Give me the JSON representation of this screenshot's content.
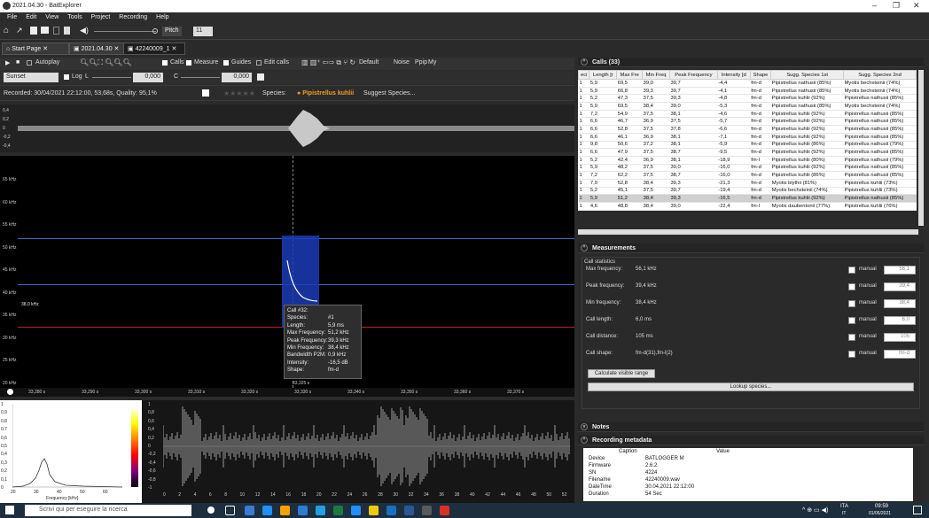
{
  "window": {
    "title": "2021.04.30 - BatExplorer",
    "minimize": "–",
    "maximize": "❐",
    "close": "✕"
  },
  "menu": [
    "File",
    "Edit",
    "View",
    "Tools",
    "Project",
    "Recording",
    "Help"
  ],
  "toolbar": {
    "pitch_label": "Pitch",
    "pitch_value": "11"
  },
  "tabs": [
    {
      "label": "Start Page"
    },
    {
      "label": "2021.04.30"
    },
    {
      "label": "42240009_1"
    }
  ],
  "view_toolbar": {
    "autoplay": "Autoplay",
    "calls": "Calls",
    "measure": "Measure",
    "guides": "Guides",
    "edit_calls": "Edit calls",
    "default": "Default",
    "noise": "Noise",
    "ppip": "Ppip",
    "my": "My"
  },
  "scale_toolbar": {
    "palette": "Sunset",
    "log": "Log",
    "l": "L",
    "c": "C",
    "value1": "0,000",
    "value2": "0,000"
  },
  "info": {
    "recorded": "Recorded: 30/04/2021 22:12:00, 53,68s, Quality: 95,1%",
    "stars": "★★★★★",
    "species_label": "Species:",
    "species_value": "Pipistrellus kuhlii",
    "suggest": "Suggest Species..."
  },
  "waveform": {
    "yticks": [
      "0,4",
      "0,2",
      "0",
      "-0,2",
      "-0,4"
    ]
  },
  "spectrogram": {
    "yticks": [
      "65 kHz",
      "60 kHz",
      "55 kHz",
      "50 kHz",
      "45 kHz",
      "40 kHz",
      "35 kHz",
      "30 kHz",
      "25 kHz",
      "20 kHz"
    ],
    "xticks": [
      "33,280 s",
      "33,290 s",
      "33,300 s",
      "33,310 s",
      "33,320 s",
      "33,330 s",
      "33,340 s",
      "33,350 s",
      "33,360 s",
      "33,370 s"
    ],
    "cursor_freq": "38,0 kHz",
    "cursor_time": "33,325 s",
    "tooltip": [
      [
        "Call #32:",
        ""
      ],
      [
        "Species:",
        "#1"
      ],
      [
        "Length:",
        "5,9 ms"
      ],
      [
        "Max Frequency:",
        "51,2 kHz"
      ],
      [
        "Peak Frequency:",
        "39,3 kHz"
      ],
      [
        "Min Frequency:",
        "38,4 kHz"
      ],
      [
        "Bandwidth P2M:",
        "0,9 kHz"
      ],
      [
        "Intensity:",
        "-16,5 dB"
      ],
      [
        "Shape:",
        "fm-d"
      ]
    ]
  },
  "spectrum": {
    "xlabel": "Frequency [kHz]",
    "yticks": [
      "1",
      "0,9",
      "0,8",
      "0,7",
      "0,6",
      "0,5",
      "0,4",
      "0,3",
      "0,2",
      "0,1",
      "0"
    ],
    "xticks": [
      "20",
      "30",
      "40",
      "50",
      "60"
    ]
  },
  "envelope": {
    "yticks": [
      "1",
      "0,8",
      "0,6",
      "0,4",
      "0,2",
      "0",
      "-0,2",
      "-0,4",
      "-0,6",
      "-0,8",
      "-1"
    ],
    "xticks": [
      "0",
      "2",
      "4",
      "6",
      "8",
      "10",
      "12",
      "14",
      "16",
      "18",
      "20",
      "22",
      "24",
      "26",
      "28",
      "30",
      "32",
      "34",
      "36",
      "38",
      "40",
      "42",
      "44",
      "46",
      "48",
      "50",
      "52"
    ]
  },
  "calls_panel": {
    "title": "Calls (33)",
    "columns": [
      "eci",
      "Length [r",
      "Max Fre",
      "Min Freq",
      "Peak Frequency",
      "Intensity [d",
      "Shape",
      "Sugg. Species 1st",
      "Sugg. Species 2nd"
    ],
    "rows": [
      [
        "1",
        "5,9",
        "69,5",
        "39,0",
        "39,7",
        "-4,4",
        "fm-d",
        "Pipistrellus nathusii (85%)",
        "Myotis bechsteinii (74%)"
      ],
      [
        "1",
        "5,9",
        "66,8",
        "39,3",
        "39,7",
        "-4,1",
        "fm-d",
        "Pipistrellus nathusii (85%)",
        "Myotis bechsteinii (74%)"
      ],
      [
        "1",
        "5,2",
        "47,3",
        "37,5",
        "39,3",
        "-4,8",
        "fm-d",
        "Pipistrellus kuhlii (92%)",
        "Pipistrellus nathusii (85%)"
      ],
      [
        "1",
        "5,9",
        "69,5",
        "38,4",
        "39,0",
        "-5,3",
        "fm-d",
        "Pipistrellus nathusii (85%)",
        "Myotis bechsteinii (74%)"
      ],
      [
        "1",
        "7,2",
        "54,9",
        "37,5",
        "38,1",
        "-4,6",
        "fm-d",
        "Pipistrellus kuhlii (92%)",
        "Pipistrellus nathusii (85%)"
      ],
      [
        "1",
        "6,6",
        "46,7",
        "36,9",
        "37,5",
        "-5,7",
        "fm-d",
        "Pipistrellus kuhlii (92%)",
        "Pipistrellus nathusii (85%)"
      ],
      [
        "1",
        "6,6",
        "52,8",
        "37,5",
        "37,8",
        "-6,6",
        "fm-d",
        "Pipistrellus kuhlii (92%)",
        "Pipistrellus nathusii (85%)"
      ],
      [
        "1",
        "6,6",
        "46,1",
        "36,9",
        "38,1",
        "-7,1",
        "fm-d",
        "Pipistrellus kuhlii (92%)",
        "Pipistrellus nathusii (85%)"
      ],
      [
        "1",
        "9,8",
        "50,6",
        "37,2",
        "38,1",
        "-5,9",
        "fm-d",
        "Pipistrellus kuhlii (86%)",
        "Pipistrellus nathusii (79%)"
      ],
      [
        "1",
        "6,6",
        "47,9",
        "37,5",
        "38,7",
        "-9,5",
        "fm-d",
        "Pipistrellus kuhlii (92%)",
        "Pipistrellus nathusii (85%)"
      ],
      [
        "1",
        "5,2",
        "42,4",
        "36,9",
        "38,1",
        "-18,9",
        "fm-l",
        "Pipistrellus kuhlii (80%)",
        "Pipistrellus nathusii (79%)"
      ],
      [
        "1",
        "5,9",
        "48,2",
        "37,5",
        "39,0",
        "-16,0",
        "fm-d",
        "Pipistrellus kuhlii (92%)",
        "Pipistrellus nathusii (85%)"
      ],
      [
        "1",
        "7,2",
        "62,2",
        "37,5",
        "38,7",
        "-16,0",
        "fm-d",
        "Pipistrellus kuhlii (86%)",
        "Pipistrellus nathusii (85%)"
      ],
      [
        "1",
        "7,9",
        "52,8",
        "38,4",
        "39,3",
        "-21,3",
        "fm-d",
        "Myotis blythii (81%)",
        "Pipistrellus kuhlii (73%)"
      ],
      [
        "1",
        "5,2",
        "45,1",
        "37,5",
        "39,7",
        "-19,4",
        "fm-d",
        "Myotis bechsteinii (74%)",
        "Pipistrellus kuhlii (73%)"
      ],
      [
        "1",
        "5,9",
        "51,2",
        "38,4",
        "39,3",
        "-16,5",
        "fm-d",
        "Pipistrellus kuhlii (92%)",
        "Pipistrellus nathusii (85%)"
      ],
      [
        "1",
        "4,6",
        "48,8",
        "38,4",
        "39,0",
        "-22,4",
        "fm-l",
        "Myotis daubentonii (77%)",
        "Pipistrellus kuhlii (76%)"
      ]
    ],
    "highlighted_row": 15
  },
  "measurements": {
    "title": "Measurements",
    "group": "Call statistics",
    "items": [
      {
        "label": "Max frequency:",
        "value": "56,1 kHz",
        "manual": "manual",
        "spin": "56,1"
      },
      {
        "label": "Peak frequency:",
        "value": "39,4 kHz",
        "manual": "manual",
        "spin": "39,4"
      },
      {
        "label": "Min frequency:",
        "value": "38,4 kHz",
        "manual": "manual",
        "spin": "38,4"
      },
      {
        "label": "Call length:",
        "value": "6,0 ms",
        "manual": "manual",
        "spin": "6,0"
      },
      {
        "label": "Call distance:",
        "value": "105 ms",
        "manual": "manual",
        "spin": "105"
      },
      {
        "label": "Call shape:",
        "value": "fm-d(31),fm-l(2)",
        "manual": "manual",
        "spin": "fm-d"
      }
    ],
    "calc_button": "Calculate visible range",
    "lookup_button": "Lookup species..."
  },
  "notes": {
    "title": "Notes"
  },
  "metadata": {
    "title": "Recording metadata",
    "col_caption": "Caption",
    "col_value": "Value",
    "rows": [
      [
        "Device",
        "BATLOGGER M"
      ],
      [
        "Firmware",
        "2.6.2"
      ],
      [
        "SN",
        "4224"
      ],
      [
        "Filename",
        "42240009.wav"
      ],
      [
        "DateTime",
        "30.04.2021 22:12:00"
      ],
      [
        "Duration",
        "54 Sec"
      ]
    ]
  },
  "taskbar": {
    "search_placeholder": "Scrivi qui per eseguire la ricerca",
    "lang": "ITA",
    "lang2": "IT",
    "time": "09:59",
    "date": "01/05/2021"
  },
  "colors": {
    "accent_species": "#f0a020",
    "highlight": "#1b4fd6"
  }
}
